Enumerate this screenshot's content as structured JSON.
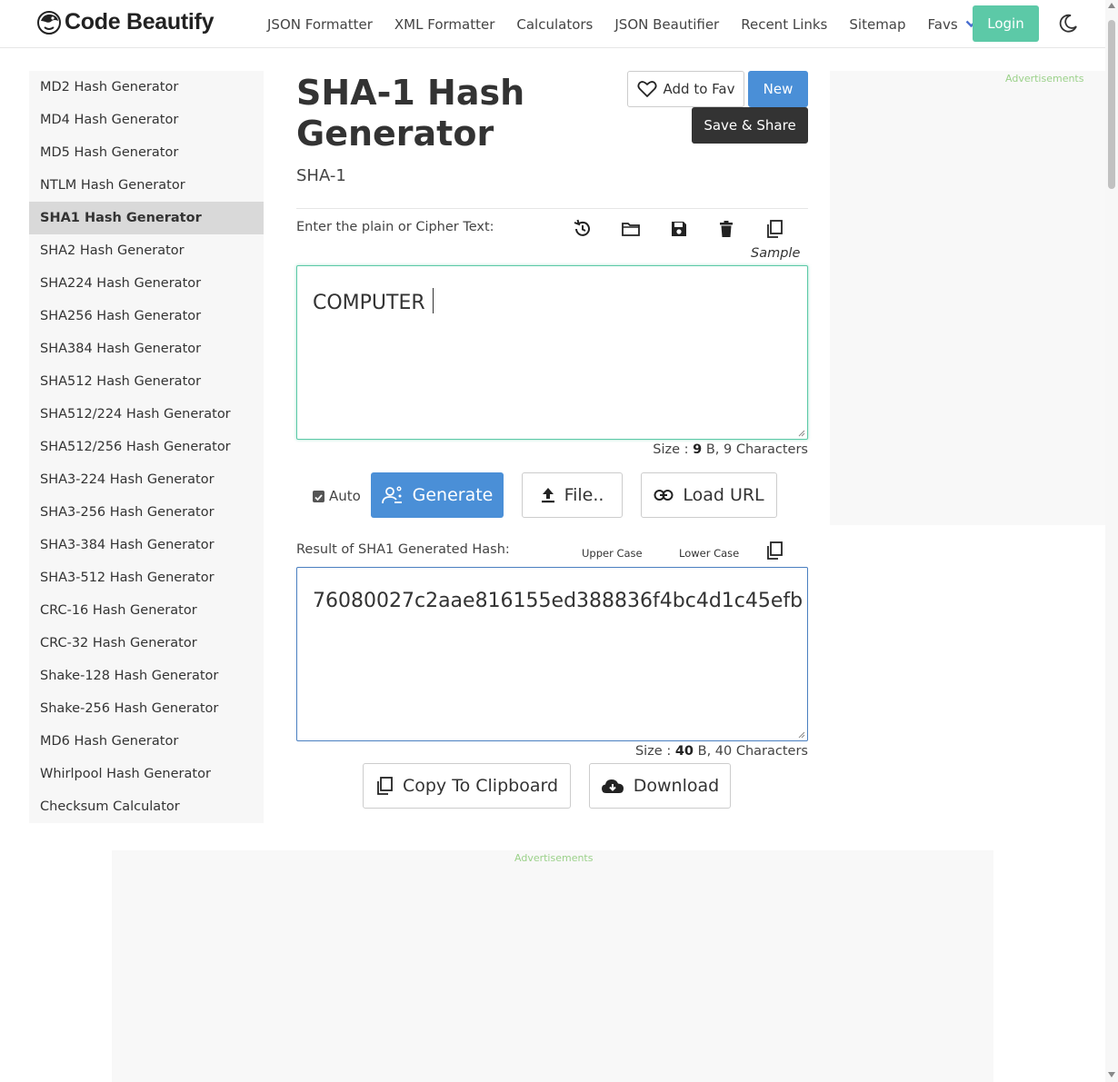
{
  "header": {
    "logo_text": "Code Beautify",
    "nav": [
      "JSON Formatter",
      "XML Formatter",
      "Calculators",
      "JSON Beautifier",
      "Recent Links",
      "Sitemap",
      "Favs"
    ],
    "login_label": "Login"
  },
  "sidebar": {
    "items": [
      {
        "label": "MD2 Hash Generator"
      },
      {
        "label": "MD4 Hash Generator"
      },
      {
        "label": "MD5 Hash Generator"
      },
      {
        "label": "NTLM Hash Generator"
      },
      {
        "label": "SHA1 Hash Generator",
        "active": true
      },
      {
        "label": "SHA2 Hash Generator"
      },
      {
        "label": "SHA224 Hash Generator"
      },
      {
        "label": "SHA256 Hash Generator"
      },
      {
        "label": "SHA384 Hash Generator"
      },
      {
        "label": "SHA512 Hash Generator"
      },
      {
        "label": "SHA512/224 Hash Generator"
      },
      {
        "label": "SHA512/256 Hash Generator"
      },
      {
        "label": "SHA3-224 Hash Generator"
      },
      {
        "label": "SHA3-256 Hash Generator"
      },
      {
        "label": "SHA3-384 Hash Generator"
      },
      {
        "label": "SHA3-512 Hash Generator"
      },
      {
        "label": "CRC-16 Hash Generator"
      },
      {
        "label": "CRC-32 Hash Generator"
      },
      {
        "label": "Shake-128 Hash Generator"
      },
      {
        "label": "Shake-256 Hash Generator"
      },
      {
        "label": "MD6 Hash Generator"
      },
      {
        "label": "Whirlpool Hash Generator"
      },
      {
        "label": "Checksum Calculator"
      }
    ]
  },
  "main": {
    "title": "SHA-1 Hash Generator",
    "subtitle": "SHA-1",
    "add_fav_label": "Add to Fav",
    "new_label": "New",
    "save_share_label": "Save & Share",
    "input_label": "Enter the plain or Cipher Text:",
    "sample_label": "Sample",
    "input_value": "COMPUTER",
    "input_size": {
      "prefix": "Size : ",
      "bytes": "9",
      "suffix": " B, 9 Characters"
    },
    "auto_label": "Auto",
    "auto_checked": true,
    "generate_label": "Generate",
    "file_label": "File..",
    "load_url_label": "Load URL",
    "result_label": "Result of SHA1 Generated Hash:",
    "upper_case_label": "Upper Case",
    "lower_case_label": "Lower Case",
    "output_value": "76080027c2aae816155ed388836f4bc4d1c45efb",
    "output_size": {
      "prefix": "Size : ",
      "bytes": "40",
      "suffix": " B, 40 Characters"
    },
    "copy_label": "Copy To Clipboard",
    "download_label": "Download"
  },
  "ads": {
    "right_label": "Advertisements",
    "bottom_label": "Advertisements"
  },
  "colors": {
    "accent_green": "#5cc9a7",
    "accent_blue": "#4a8fd7",
    "dark_button": "#333333"
  },
  "icons": [
    "logo-icon",
    "chevron-down-icon",
    "moon-icon",
    "heart-icon",
    "history-icon",
    "folder-icon",
    "save-icon",
    "trash-icon",
    "copy-icon",
    "generate-icon",
    "upload-icon",
    "link-icon",
    "cloud-download-icon"
  ]
}
